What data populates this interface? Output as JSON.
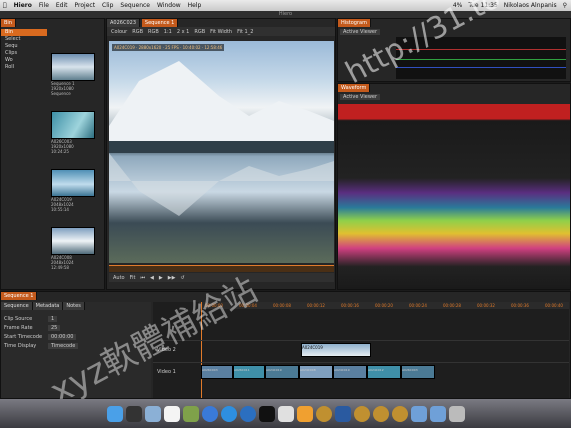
{
  "menubar": {
    "app": "Hiero",
    "items": [
      "File",
      "Edit",
      "Project",
      "Clip",
      "Sequence",
      "Window",
      "Help"
    ],
    "battery": "4%",
    "clock": "Tue 11:35",
    "user": "Nikolaos Alnpanis"
  },
  "window_title": "Hiero",
  "bin": {
    "tab": "Bin",
    "tree": [
      "Bin",
      "Select",
      "Sequ",
      "Clips",
      "Wo",
      "Roll"
    ],
    "clips": [
      {
        "name": "Sequence 1",
        "info1": "1920x1080",
        "info2": "Sequence"
      },
      {
        "name": "A026C003",
        "info1": "1920x1080",
        "info2": "10:24:25"
      },
      {
        "name": "A024C019",
        "info1": "2048x1024",
        "info2": "10:55:14"
      },
      {
        "name": "A024C008",
        "info1": "2048x1024",
        "info2": "12:49:58"
      }
    ]
  },
  "viewer": {
    "tabs": [
      "A026C023",
      "Sequence 1"
    ],
    "controls": [
      "Colour",
      "RGB",
      "RGB",
      "1:1",
      "1:1",
      "2 x 1",
      "RGB",
      "Fit Width",
      "Fit 1_2"
    ],
    "clip_overlay": "A024C019 · 2880x1620 · 25 FPS · 10:40:02 · 12:58:46",
    "transport": [
      "Auto",
      "Fit"
    ]
  },
  "histogram": {
    "tab": "Histogram",
    "mode": "Active Viewer"
  },
  "waveform": {
    "tab": "Waveform",
    "mode": "Active Viewer"
  },
  "sequence": {
    "tab": "Sequence 1",
    "tabs": [
      "Sequence",
      "Metadata",
      "Notes"
    ],
    "props": [
      {
        "label": "Clip Source",
        "value": "1"
      },
      {
        "label": "Frame Rate",
        "value": "25"
      },
      {
        "label": "Start Timecode",
        "value": "00:00:00"
      },
      {
        "label": "Time Display",
        "value": "Timecode"
      }
    ],
    "ruler": [
      "00:00:00",
      "00:00:04",
      "00:00:08",
      "00:00:12",
      "00:00:16",
      "00:00:20",
      "00:00:24",
      "00:00:28",
      "00:00:32",
      "00:00:36",
      "00:00:40"
    ],
    "tracks": [
      "Video 2",
      "Video 1"
    ],
    "video1_clips": [
      "A026C003",
      "A026C011",
      "A024C019",
      "A024C008",
      "A024C019",
      "A024C012",
      "A026C003"
    ],
    "video2_clip": "A024C019"
  },
  "watermark": {
    "url": "http://31.to",
    "text": "xyz軟體補給站"
  }
}
